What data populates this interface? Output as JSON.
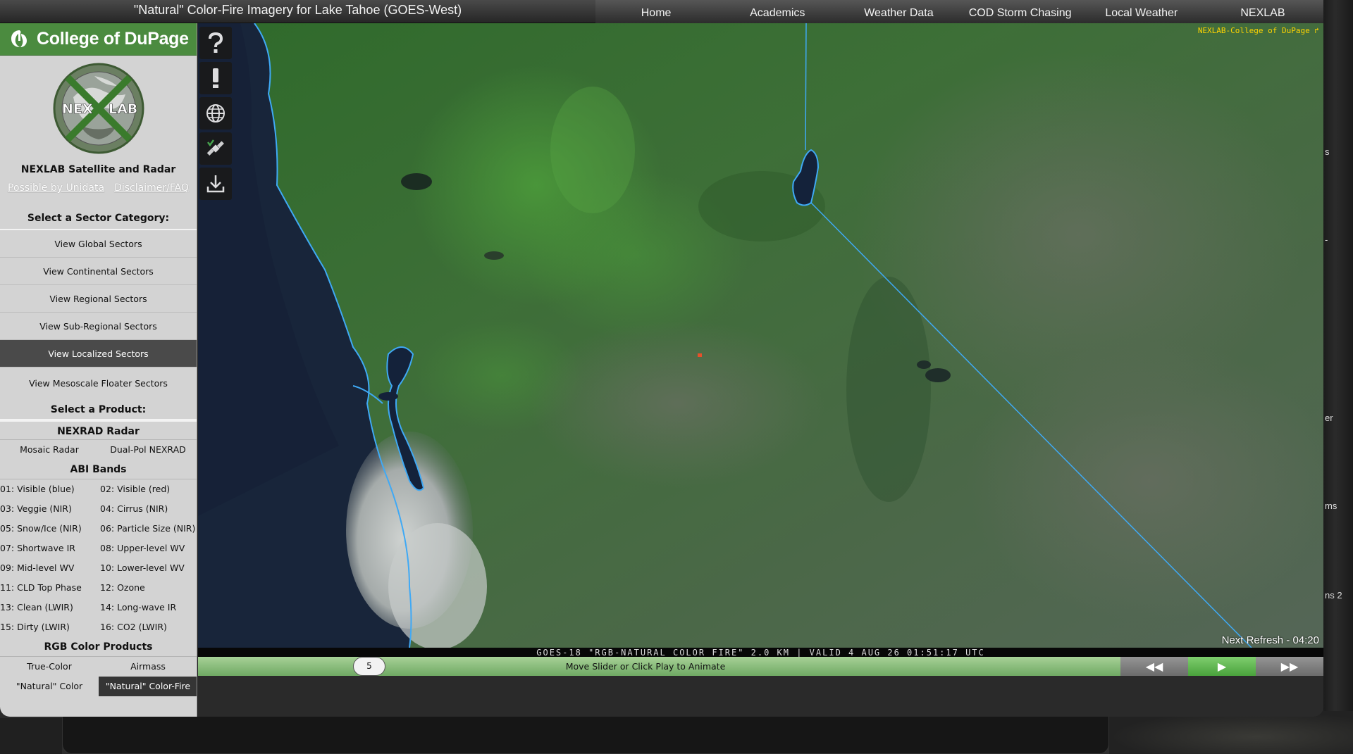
{
  "header": {
    "title": "\"Natural\" Color-Fire Imagery for Lake Tahoe (GOES-West)",
    "nav": [
      "Home",
      "Academics",
      "Weather Data",
      "COD Storm Chasing",
      "Local Weather",
      "NEXLAB"
    ]
  },
  "sidebar": {
    "brand": "College of DuPage",
    "logo_text_left": "NEX",
    "logo_text_right": "LAB",
    "lab_title": "NEXLAB Satellite and Radar",
    "links": [
      "Possible by Unidata",
      "Disclaimer/FAQ"
    ],
    "sector_heading": "Select a Sector Category:",
    "sectors": [
      {
        "label": "View Global Sectors",
        "active": false
      },
      {
        "label": "View Continental Sectors",
        "active": false
      },
      {
        "label": "View Regional Sectors",
        "active": false
      },
      {
        "label": "View Sub-Regional Sectors",
        "active": false
      },
      {
        "label": "View Localized Sectors",
        "active": true
      },
      {
        "label": "View Mesoscale Floater Sectors",
        "active": false
      }
    ],
    "product_heading": "Select a Product:",
    "nexrad_heading": "NEXRAD Radar",
    "nexrad_items": [
      "Mosaic Radar",
      "Dual-Pol NEXRAD"
    ],
    "abi_heading": "ABI Bands",
    "abi_bands": [
      "01: Visible (blue)",
      "02: Visible (red)",
      "03: Veggie (NIR)",
      "04: Cirrus (NIR)",
      "05: Snow/Ice (NIR)",
      "06: Particle Size (NIR)",
      "07: Shortwave IR",
      "08: Upper-level WV",
      "09: Mid-level WV",
      "10: Lower-level WV",
      "11: CLD Top Phase",
      "12: Ozone",
      "13: Clean (LWIR)",
      "14: Long-wave IR",
      "15: Dirty (LWIR)",
      "16: CO2 (LWIR)"
    ],
    "rgb_heading": "RGB Color Products",
    "rgb_items": [
      {
        "label": "True-Color",
        "active": false
      },
      {
        "label": "Airmass",
        "active": false
      },
      {
        "label": "\"Natural\" Color",
        "active": false
      },
      {
        "label": "\"Natural\" Color-Fire",
        "active": true
      }
    ]
  },
  "tools": [
    "help-icon",
    "alert-icon",
    "globe-icon",
    "satellite-icon",
    "download-icon"
  ],
  "map": {
    "watermark": "NEXLAB-College of DuPage ↱",
    "caption": "GOES-18 \"RGB-NATURAL COLOR FIRE\" 2.0 KM | VALID 4 AUG 26 01:51:17 UTC",
    "next_refresh": "Next Refresh - 04:20"
  },
  "animation": {
    "frame_count": "5",
    "hint": "Move Slider or Click Play to Animate",
    "rewind": "◀◀",
    "play": "▶",
    "forward": "▶▶"
  },
  "background": {
    "fragments": [
      "s",
      "-",
      "er",
      "ms",
      "ns 2"
    ]
  },
  "colors": {
    "brand_green": "#4b8b3f",
    "boundary_blue": "#3fa9f5",
    "watermark_yellow": "#ffd400",
    "fire_red": "#e8502a"
  }
}
